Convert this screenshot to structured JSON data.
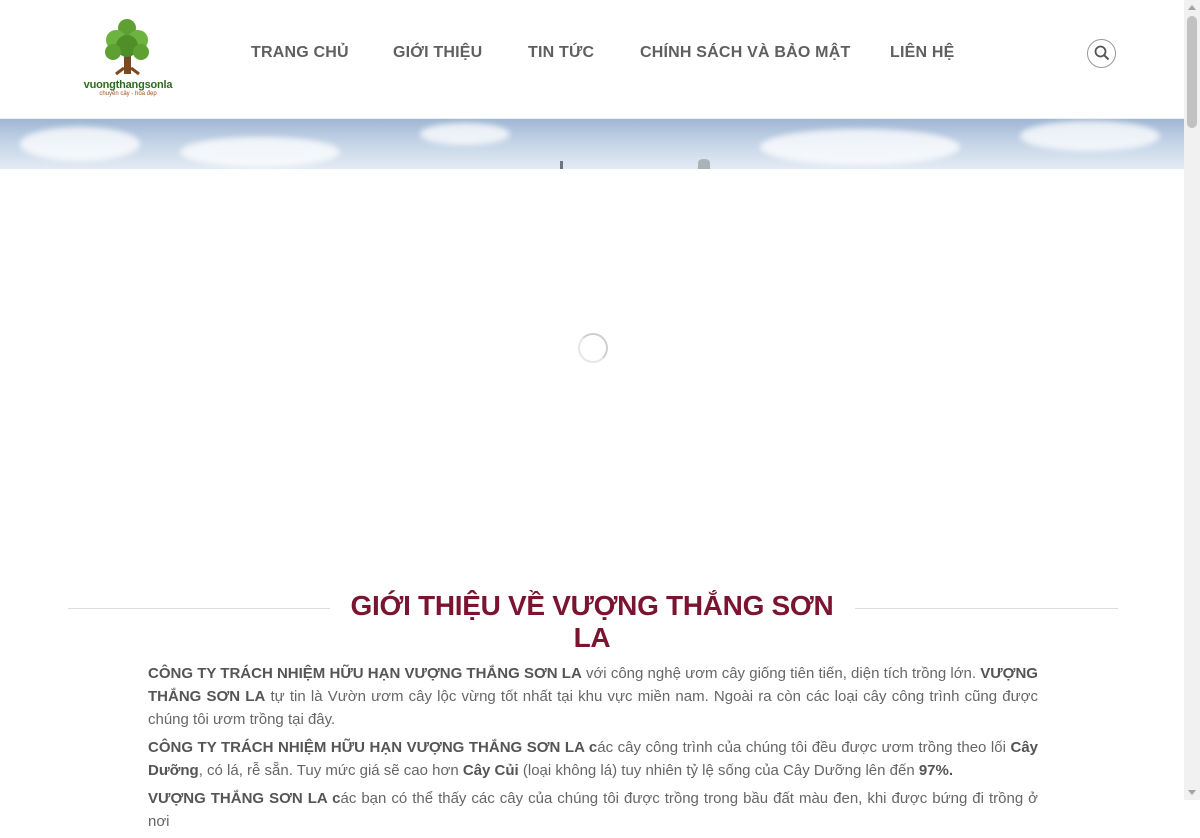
{
  "header": {
    "logo": {
      "name": "vuongthangsonla",
      "tagline": "chuyên cây - hoa đẹp"
    },
    "nav": [
      {
        "label": "TRANG CHỦ"
      },
      {
        "label": "GIỚI THIỆU"
      },
      {
        "label": "TIN TỨC"
      },
      {
        "label": "CHÍNH SÁCH VÀ BẢO MẬT"
      },
      {
        "label": "LIÊN HỆ"
      }
    ],
    "search_icon": "search-icon"
  },
  "main": {
    "loading_icon": "loading-spinner-icon",
    "section_title": "GIỚI THIỆU VỀ VƯỢNG THẮNG SƠN LA",
    "paragraphs": [
      {
        "p1_bold1": "CÔNG TY TRÁCH NHIỆM HỮU HẠN VƯỢNG THẮNG SƠN LA",
        "p1_text1": " với công nghệ ươm cây giống tiên tiến, diện tích trồng lớn. ",
        "p1_bold2": "VƯỢNG THẮNG SƠN LA",
        "p1_text2": " tự tin là Vườn ươm cây lộc vừng tốt nhất tại khu vực miền nam. Ngoài ra còn các loại cây công trình cũng được chúng tôi ươm trồng tại đây."
      },
      {
        "p2_bold1": "CÔNG TY TRÁCH NHIỆM HỮU HẠN VƯỢNG THẮNG SƠN LA  c",
        "p2_text1": "ác cây công trình của chúng tôi đều được ươm trồng theo lối ",
        "p2_bold2": "Cây Dưỡng",
        "p2_text2": ", có lá, rễ sẵn. Tuy mức giá sẽ cao hơn ",
        "p2_bold3": "Cây Củi",
        "p2_text3": " (loại không lá) tuy nhiên tỷ lệ sống của Cây Dưỡng lên đến ",
        "p2_bold4": "97%."
      },
      {
        "p3_bold1": "VƯỢNG THẮNG SƠN LA c",
        "p3_text1": "ác bạn có thể thấy các cây của chúng tôi được trồng trong bầu đất màu đen, khi được bứng đi trồng ở nơi"
      }
    ]
  },
  "colors": {
    "title": "#7a1430",
    "nav_text": "#5f5f5f",
    "body_text": "#666666",
    "logo_green": "#2e6b1e"
  }
}
